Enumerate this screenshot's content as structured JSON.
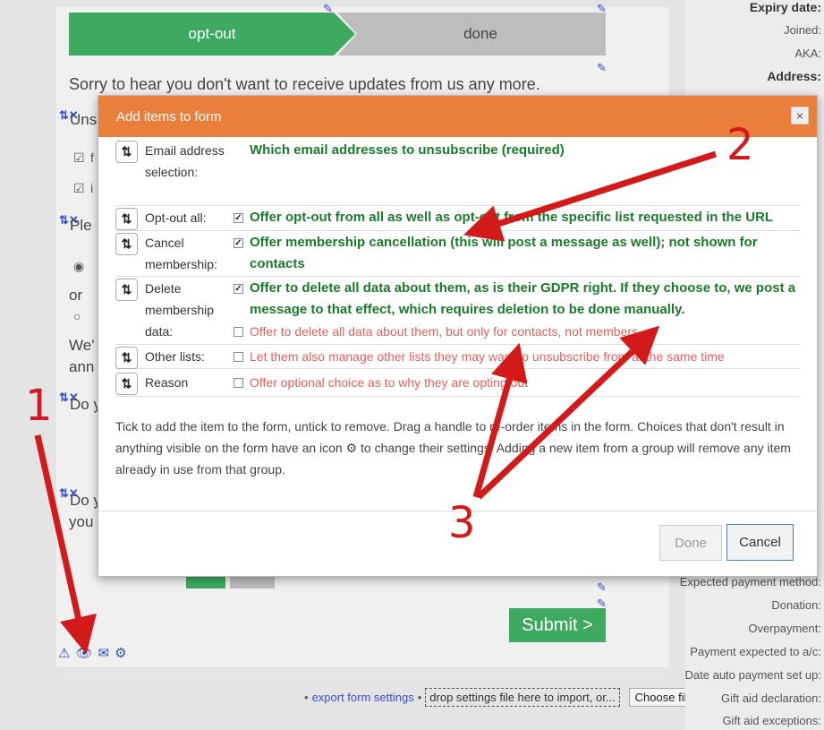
{
  "steps": {
    "current": "opt-out",
    "next": "done"
  },
  "page": {
    "sorry_text": "Sorry to hear you don't want to receive updates from us any more.",
    "frag_uns": "Uns",
    "frag_ple": "Ple",
    "frag_f": "f",
    "frag_i": "i",
    "frag_or": "or",
    "frag_we": "We'",
    "frag_ann": "ann",
    "frag_do1": "Do y",
    "frag_do2": "Do y",
    "frag_you": "you",
    "submit_label": "Submit >"
  },
  "footer": {
    "bullet1": "•",
    "export_link": "export form settings",
    "bullet2": "•",
    "drop_text": "drop settings file here to import, or...",
    "choose_file": "Choose file"
  },
  "sidebar": {
    "labels": [
      "Expiry date:",
      "Joined:",
      "AKA:",
      "Address:",
      "Expected payment method:",
      "Donation:",
      "Overpayment:",
      "Payment expected to a/c:",
      "Date auto payment set up:",
      "Gift aid declaration:",
      "Gift aid exceptions:"
    ]
  },
  "modal": {
    "title": "Add items to form",
    "close": "×",
    "rows": [
      {
        "label": "Email address selection:",
        "options": [
          {
            "text": "Which email addresses to unsubscribe (required)",
            "checked": null
          }
        ]
      },
      {
        "label": "Opt-out all:",
        "options": [
          {
            "text": "Offer opt-out from all as well as opt-out from the specific list requested in the URL",
            "checked": true
          }
        ]
      },
      {
        "label": "Cancel membership:",
        "options": [
          {
            "text": "Offer membership cancellation (this will post a message as well); not shown for contacts",
            "checked": true
          }
        ]
      },
      {
        "label": "Delete membership data:",
        "options": [
          {
            "text": "Offer to delete all data about them, as is their GDPR right. If they choose to, we post a message to that effect, which requires deletion to be done manually.",
            "checked": true
          },
          {
            "text": "Offer to delete all data about them, but only for contacts, not members.",
            "checked": false
          }
        ]
      },
      {
        "label": "Other lists:",
        "options": [
          {
            "text": "Let them also manage other lists they may want to unsubscribe from at the same time",
            "checked": false
          }
        ]
      },
      {
        "label": "Reason",
        "options": [
          {
            "text": "Offer optional choice as to why they are opting out",
            "checked": false
          }
        ]
      }
    ],
    "help_text": "Tick to add the item to the form, untick to remove. Drag a handle to re-order items in the form. Choices that don't result in anything visible on the form have an icon ⚙ to change their settings. Adding a new item from a group will remove any item already in use from that group.",
    "done_label": "Done",
    "cancel_label": "Cancel"
  },
  "annotations": {
    "one": "1",
    "two": "2",
    "three": "3",
    "color": "#d21a1a"
  },
  "colors": {
    "green": "#3daa5f",
    "orange": "#ea7f3c",
    "blue_icon": "#2f4fb5"
  }
}
